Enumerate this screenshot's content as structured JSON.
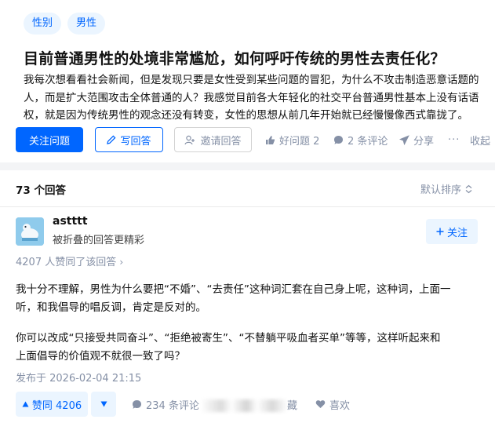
{
  "question": {
    "tags": [
      "性别",
      "男性"
    ],
    "title": "目前普通男性的处境非常尴尬，如何呼吁传统的男性去责任化？",
    "description_lines": [
      "我每次想看看社会新闻，但是发现只要是女性受到某些问题的冒犯，为什么不攻击制造恶意话题的",
      "人，而是扩大范围攻击全体普通的人？我感觉目前各大年轻化的社交平台普通男性基本上没有话语",
      "权，就是因为传统男性的观念还没有转变，女性的思想从前几年开始就已经慢慢像西式靠拢了。"
    ],
    "actions": {
      "follow": "关注问题",
      "write": "写回答",
      "invite": "邀请回答",
      "good_question": "好问题 2",
      "comments": "2 条评论",
      "share": "分享",
      "more": "···",
      "collapse": "收起"
    }
  },
  "answers_header": {
    "count": "73 个回答",
    "sort": "默认排序"
  },
  "answer": {
    "author": "astttt",
    "author_sub": "被折叠的回答更精彩",
    "follow": "关注",
    "agree_count": "4207 人赞同了该回答",
    "paragraphs": [
      [
        "我十分不理解，男性为什么要把“不婚”、“去责任”这种词汇套在自己身上呢，这种词，上面一",
        "听，和我倡导的唱反调，肯定是反对的。"
      ],
      [
        "你可以改成“只接受共同奋斗”、“拒绝被寄生”、“不替躺平吸血者买单”等等，这样听起来和",
        "上面倡导的价值观不就很一致了吗？"
      ]
    ],
    "published": "发布于 2026-02-04 21:15",
    "vote_up": "赞同 4206",
    "comments": "234 条评论",
    "favorite_partial": "藏",
    "like": "喜欢"
  },
  "colors": {
    "accent": "#0066ff",
    "accent_bg": "#ebf5ff",
    "muted": "#8590a6"
  },
  "icons": [
    "pen-icon",
    "invite-icon",
    "thumb-up-icon",
    "comment-icon",
    "share-icon",
    "sort-icon",
    "plus-icon",
    "triangle-up-icon",
    "triangle-down-icon",
    "heart-icon"
  ]
}
